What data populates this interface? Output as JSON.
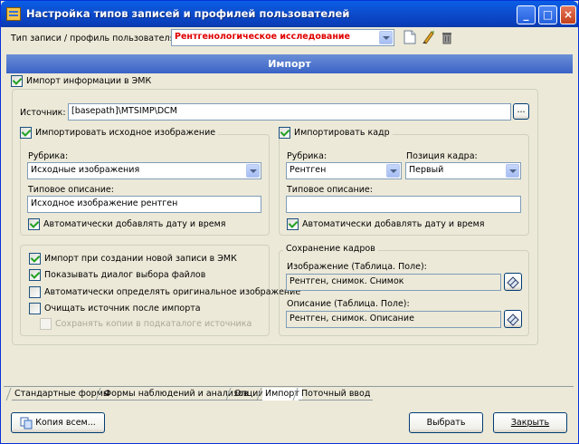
{
  "window": {
    "title": "Настройка типов записей и профилей пользователей"
  },
  "top": {
    "record_type_label": "Тип записи / профиль пользователя",
    "record_type_value": "Рентгенологическое исследование",
    "accent_color": "#e00000"
  },
  "banner": {
    "title": "Импорт"
  },
  "import_emk": {
    "label": "Импорт информации в ЭМК",
    "checked": true
  },
  "source": {
    "label": "Источник:",
    "value": "[basepath]\\MTSIMP\\DCM",
    "browse_label": "..."
  },
  "left_group": {
    "checkbox_label": "Импортировать исходное изображение",
    "rubric_label": "Рубрика:",
    "rubric_value": "Исходные изображения",
    "desc_label": "Типовое описание:",
    "desc_value": "Исходное изображение рентген",
    "auto_date_label": "Автоматически добавлять дату и время"
  },
  "right_group": {
    "checkbox_label": "Импортировать кадр",
    "rubric_label": "Рубрика:",
    "rubric_value": "Рентген",
    "position_label": "Позиция кадра:",
    "position_value": "Первый",
    "desc_label": "Типовое описание:",
    "desc_value": "",
    "auto_date_label": "Автоматически добавлять дату и время"
  },
  "options": [
    {
      "label": "Импорт при создании новой записи в  ЭМК",
      "checked": true,
      "disabled": false
    },
    {
      "label": "Показывать диалог выбора файлов",
      "checked": true,
      "disabled": false
    },
    {
      "label": "Автоматически определять оригинальное изображение",
      "checked": false,
      "disabled": false
    },
    {
      "label": "Очищать источник после импорта",
      "checked": false,
      "disabled": false
    },
    {
      "label": "Сохранять копии в подкаталоге источника",
      "checked": false,
      "disabled": true
    }
  ],
  "frames": {
    "group_title": "Сохранение кадров",
    "image_label": "Изображение (Таблица. Поле):",
    "image_value": "Рентген, снимок. Снимок",
    "desc_label": "Описание (Таблица. Поле):",
    "desc_value": "Рентген, снимок. Описание"
  },
  "tabs": [
    "Стандартные формы",
    "Формы наблюдений и анализов",
    "Опции",
    "Импорт",
    "Поточный ввод"
  ],
  "active_tab": "Импорт",
  "buttons": {
    "copy_all": "Копия всем...",
    "select": "Выбрать",
    "close": "Закрыть"
  }
}
